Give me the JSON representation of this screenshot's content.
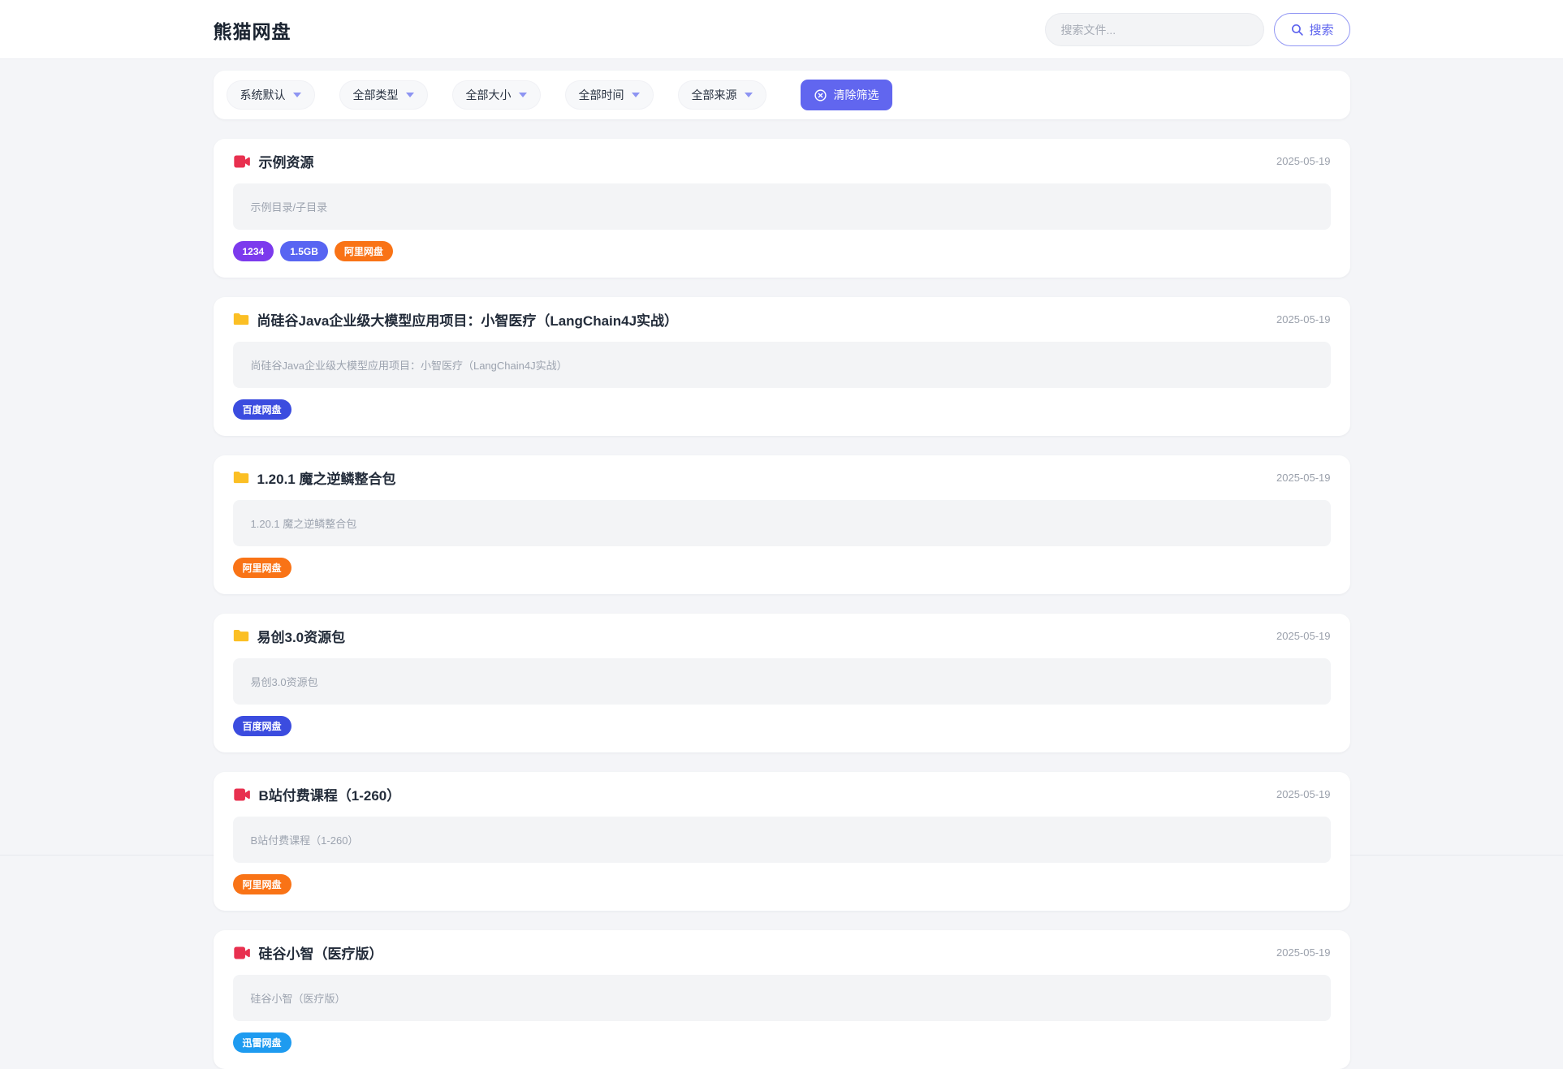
{
  "header": {
    "title": "熊猫网盘",
    "search": {
      "placeholder": "搜索文件...",
      "button_label": "搜索"
    }
  },
  "filters": {
    "dropdowns": [
      {
        "label": "系统默认"
      },
      {
        "label": "全部类型"
      },
      {
        "label": "全部大小"
      },
      {
        "label": "全部时间"
      },
      {
        "label": "全部来源"
      }
    ],
    "clear_label": "清除筛选"
  },
  "colors": {
    "accent": "#6166ef",
    "video_icon": "#e8304f",
    "folder_icon": "#fbbf24",
    "tag_purple": "#7c3aed",
    "tag_indigo": "#5865f2",
    "tag_orange": "#f97316",
    "tag_blue": "#3b4cdf",
    "tag_sky": "#1e9bf0"
  },
  "results": [
    {
      "icon": "video",
      "title": "示例资源",
      "date": "2025-05-19",
      "description": "示例目录/子目录",
      "tags": [
        {
          "label": "1234",
          "color": "#7c3aed"
        },
        {
          "label": "1.5GB",
          "color": "#5865f2"
        },
        {
          "label": "阿里网盘",
          "color": "#f97316"
        }
      ]
    },
    {
      "icon": "folder",
      "title": "尚硅谷Java企业级大模型应用项目：小智医疗（LangChain4J实战）",
      "date": "2025-05-19",
      "description": "尚硅谷Java企业级大模型应用项目：小智医疗（LangChain4J实战）",
      "tags": [
        {
          "label": "百度网盘",
          "color": "#3b4cdf"
        }
      ]
    },
    {
      "icon": "folder",
      "title": "1.20.1 魔之逆鳞整合包",
      "date": "2025-05-19",
      "description": "1.20.1 魔之逆鳞整合包",
      "tags": [
        {
          "label": "阿里网盘",
          "color": "#f97316"
        }
      ]
    },
    {
      "icon": "folder",
      "title": "易创3.0资源包",
      "date": "2025-05-19",
      "description": "易创3.0资源包",
      "tags": [
        {
          "label": "百度网盘",
          "color": "#3b4cdf"
        }
      ]
    },
    {
      "icon": "video",
      "title": "B站付费课程（1-260）",
      "date": "2025-05-19",
      "description": "B站付费课程（1-260）",
      "tags": [
        {
          "label": "阿里网盘",
          "color": "#f97316"
        }
      ]
    },
    {
      "icon": "video",
      "title": "硅谷小智（医疗版）",
      "date": "2025-05-19",
      "description": "硅谷小智（医疗版）",
      "tags": [
        {
          "label": "迅雷网盘",
          "color": "#1e9bf0"
        }
      ]
    }
  ]
}
